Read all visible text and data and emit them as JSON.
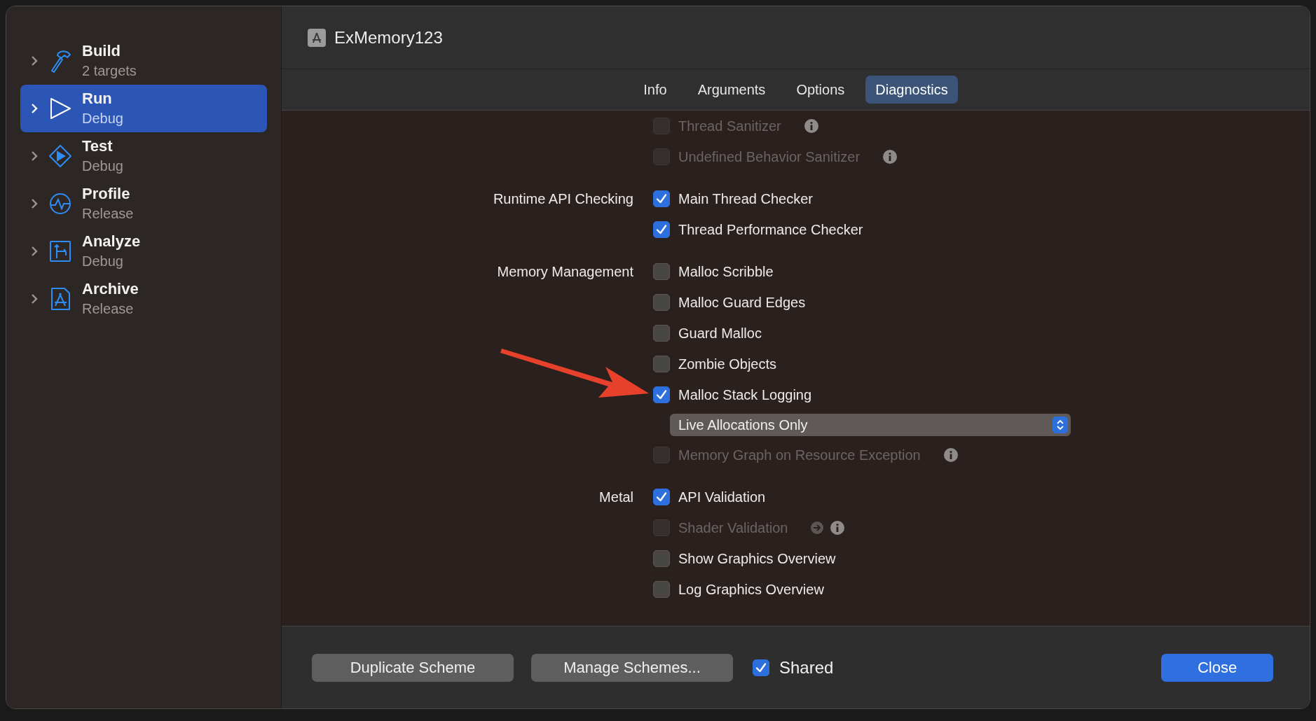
{
  "sidebar": {
    "items": [
      {
        "kind": "build",
        "title": "Build",
        "subtitle": "2 targets",
        "selected": false
      },
      {
        "kind": "run",
        "title": "Run",
        "subtitle": "Debug",
        "selected": true
      },
      {
        "kind": "test",
        "title": "Test",
        "subtitle": "Debug",
        "selected": false
      },
      {
        "kind": "profile",
        "title": "Profile",
        "subtitle": "Release",
        "selected": false
      },
      {
        "kind": "analyze",
        "title": "Analyze",
        "subtitle": "Debug",
        "selected": false
      },
      {
        "kind": "archive",
        "title": "Archive",
        "subtitle": "Release",
        "selected": false
      }
    ]
  },
  "header": {
    "title": "ExMemory123"
  },
  "tabs": [
    {
      "label": "Info",
      "selected": false
    },
    {
      "label": "Arguments",
      "selected": false
    },
    {
      "label": "Options",
      "selected": false
    },
    {
      "label": "Diagnostics",
      "selected": true
    }
  ],
  "sections": [
    {
      "items": [
        {
          "kind": "checkbox",
          "label": "Thread Sanitizer",
          "checked": false,
          "disabled": true,
          "info": true
        },
        {
          "kind": "checkbox",
          "label": "Undefined Behavior Sanitizer",
          "checked": false,
          "disabled": true,
          "info": true
        }
      ]
    },
    {
      "label": "Runtime API Checking",
      "items": [
        {
          "kind": "checkbox",
          "label": "Main Thread Checker",
          "checked": true,
          "disabled": false
        },
        {
          "kind": "checkbox",
          "label": "Thread Performance Checker",
          "checked": true,
          "disabled": false
        }
      ]
    },
    {
      "label": "Memory Management",
      "items": [
        {
          "kind": "checkbox",
          "label": "Malloc Scribble",
          "checked": false,
          "disabled": false
        },
        {
          "kind": "checkbox",
          "label": "Malloc Guard Edges",
          "checked": false,
          "disabled": false
        },
        {
          "kind": "checkbox",
          "label": "Guard Malloc",
          "checked": false,
          "disabled": false
        },
        {
          "kind": "checkbox",
          "label": "Zombie Objects",
          "checked": false,
          "disabled": false
        },
        {
          "kind": "checkbox",
          "label": "Malloc Stack Logging",
          "checked": true,
          "disabled": false
        },
        {
          "kind": "popup",
          "value": "Live Allocations Only"
        },
        {
          "kind": "checkbox",
          "label": "Memory Graph on Resource Exception",
          "checked": false,
          "disabled": true,
          "info": true
        }
      ]
    },
    {
      "label": "Metal",
      "items": [
        {
          "kind": "checkbox",
          "label": "API Validation",
          "checked": true,
          "disabled": false
        },
        {
          "kind": "checkbox",
          "label": "Shader Validation",
          "checked": false,
          "disabled": true,
          "info": true,
          "link": true
        },
        {
          "kind": "checkbox",
          "label": "Show Graphics Overview",
          "checked": false,
          "disabled": false
        },
        {
          "kind": "checkbox",
          "label": "Log Graphics Overview",
          "checked": false,
          "disabled": false
        }
      ]
    }
  ],
  "footer": {
    "duplicate": "Duplicate Scheme",
    "manage": "Manage Schemes...",
    "shared": {
      "label": "Shared",
      "checked": true
    },
    "close": "Close"
  }
}
